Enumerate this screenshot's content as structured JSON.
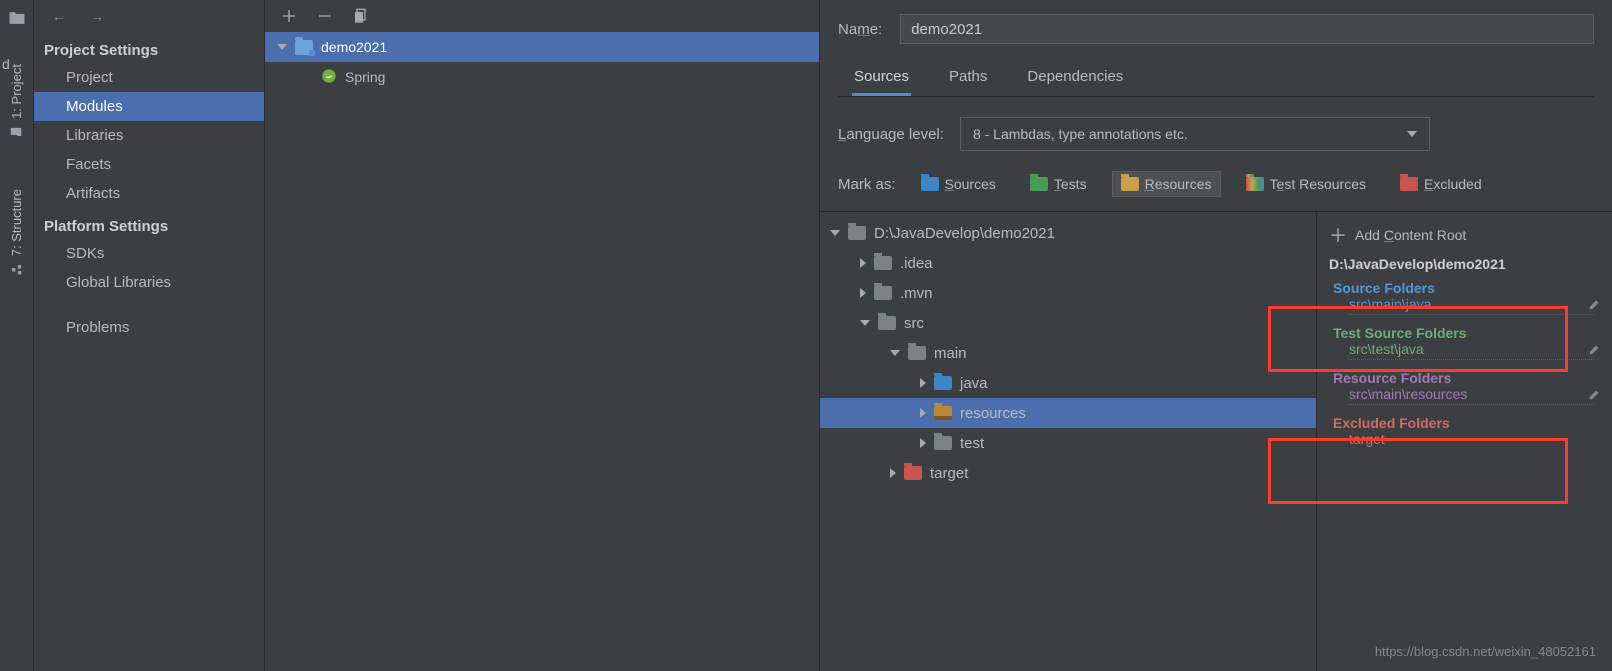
{
  "leftRail": {
    "label_project": "1: Project",
    "label_structure": "7: Structure"
  },
  "navPartial": "d",
  "sidebar": {
    "heading_proj": "Project Settings",
    "items": {
      "project": "Project",
      "modules": "Modules",
      "libraries": "Libraries",
      "facets": "Facets",
      "artifacts": "Artifacts"
    },
    "heading_platform": "Platform Settings",
    "platform_items": {
      "sdks": "SDKs",
      "global_libs": "Global Libraries"
    },
    "problems": "Problems"
  },
  "moduleTree": {
    "root": "demo2021",
    "spring": "Spring"
  },
  "details": {
    "name_label": "Name:",
    "name_value": "demo2021",
    "tabs": {
      "sources": "Sources",
      "paths": "Paths",
      "deps": "Dependencies"
    },
    "lang_label": "Language level:",
    "lang_value": "8 - Lambdas, type annotations etc.",
    "mark_as": "Mark as:",
    "marks": {
      "sources": "Sources",
      "tests": "Tests",
      "resources": "Resources",
      "test_resources": "Test Resources",
      "excluded": "Excluded"
    }
  },
  "dirTree": {
    "root": "D:\\JavaDevelop\\demo2021",
    "idea": ".idea",
    "mvn": ".mvn",
    "src": "src",
    "main": "main",
    "java": "java",
    "resources": "resources",
    "test": "test",
    "target": "target"
  },
  "rightPane": {
    "add_content": "Add Content Root",
    "title": "D:\\JavaDevelop\\demo2021",
    "source_folders": "Source Folders",
    "source_path": "src\\main\\java",
    "test_folders": "Test Source Folders",
    "test_path": "src\\test\\java",
    "resource_folders": "Resource Folders",
    "resource_path": "src\\main\\resources",
    "excluded_folders": "Excluded Folders",
    "excluded_path": "target"
  },
  "watermark": "https://blog.csdn.net/weixin_48052161"
}
